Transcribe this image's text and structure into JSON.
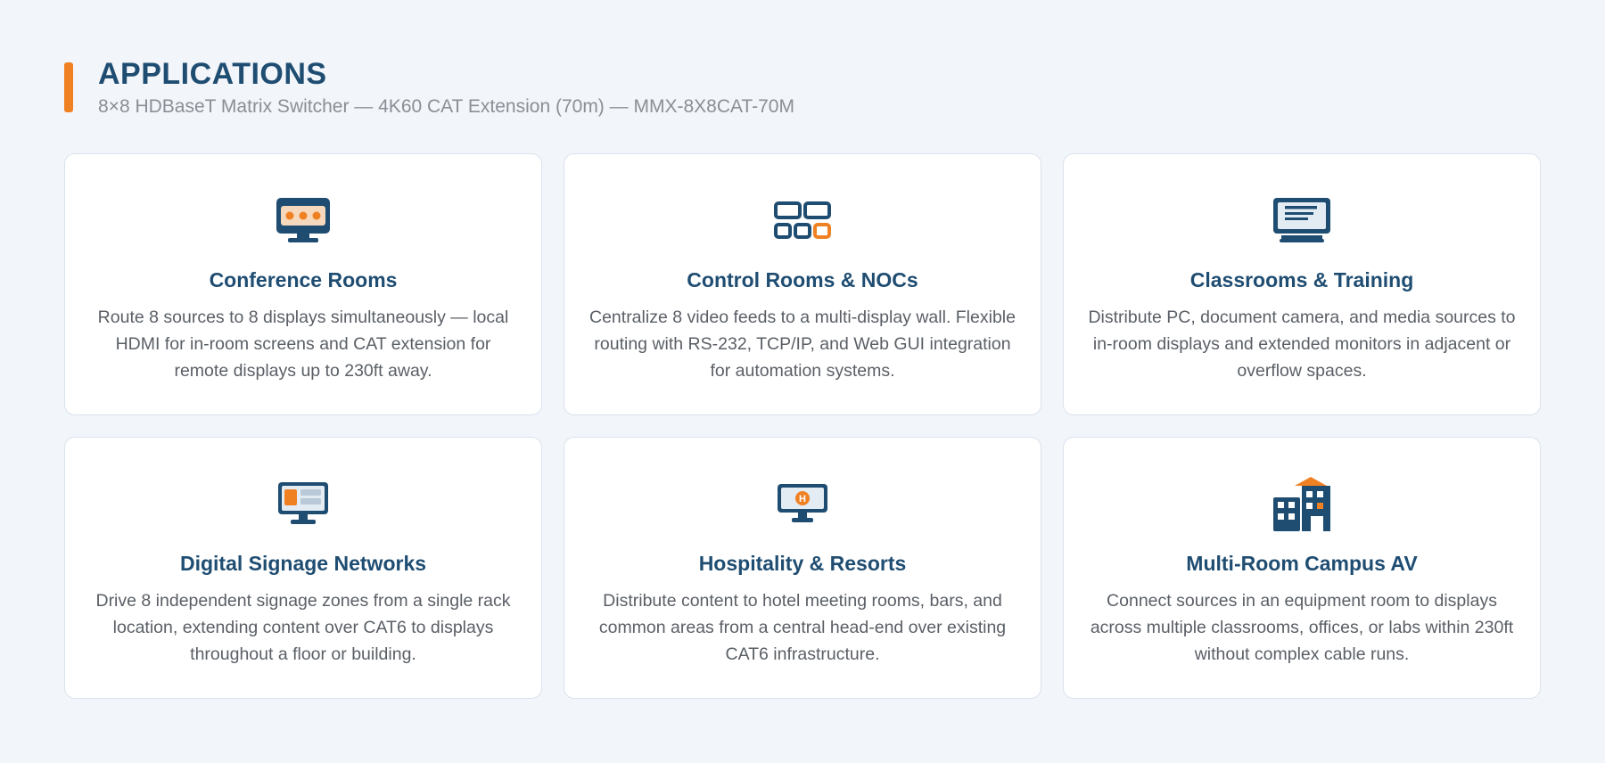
{
  "header": {
    "title": "APPLICATIONS",
    "subtitle": "8×8 HDBaseT Matrix Switcher — 4K60 CAT Extension (70m) — MMX-8X8CAT-70M"
  },
  "colors": {
    "accent": "#f08123",
    "primary": "#1f4d72",
    "background": "#f2f5f9",
    "card": "#ffffff"
  },
  "cards": [
    {
      "icon": "monitor-dots-icon",
      "title": "Conference Rooms",
      "text": "Route 8 sources to 8 displays simultaneously — local HDMI for in-room screens and CAT extension for remote displays up to 230ft away."
    },
    {
      "icon": "video-wall-icon",
      "title": "Control Rooms & NOCs",
      "text": "Centralize 8 video feeds to a multi-display wall. Flexible routing with RS-232, TCP/IP, and Web GUI integration for automation systems."
    },
    {
      "icon": "presentation-monitor-icon",
      "title": "Classrooms & Training",
      "text": "Distribute PC, document camera, and media sources to in-room displays and extended monitors in adjacent or overflow spaces."
    },
    {
      "icon": "signage-display-icon",
      "title": "Digital Signage Networks",
      "text": "Drive 8 independent signage zones from a single rack location, extending content over CAT6 to displays throughout a floor or building."
    },
    {
      "icon": "hotel-display-icon",
      "title": "Hospitality & Resorts",
      "text": "Distribute content to hotel meeting rooms, bars, and common areas from a central head-end over existing CAT6 infrastructure."
    },
    {
      "icon": "campus-buildings-icon",
      "title": "Multi-Room Campus AV",
      "text": "Connect sources in an equipment room to displays across multiple classrooms, offices, or labs within 230ft without complex cable runs."
    }
  ]
}
